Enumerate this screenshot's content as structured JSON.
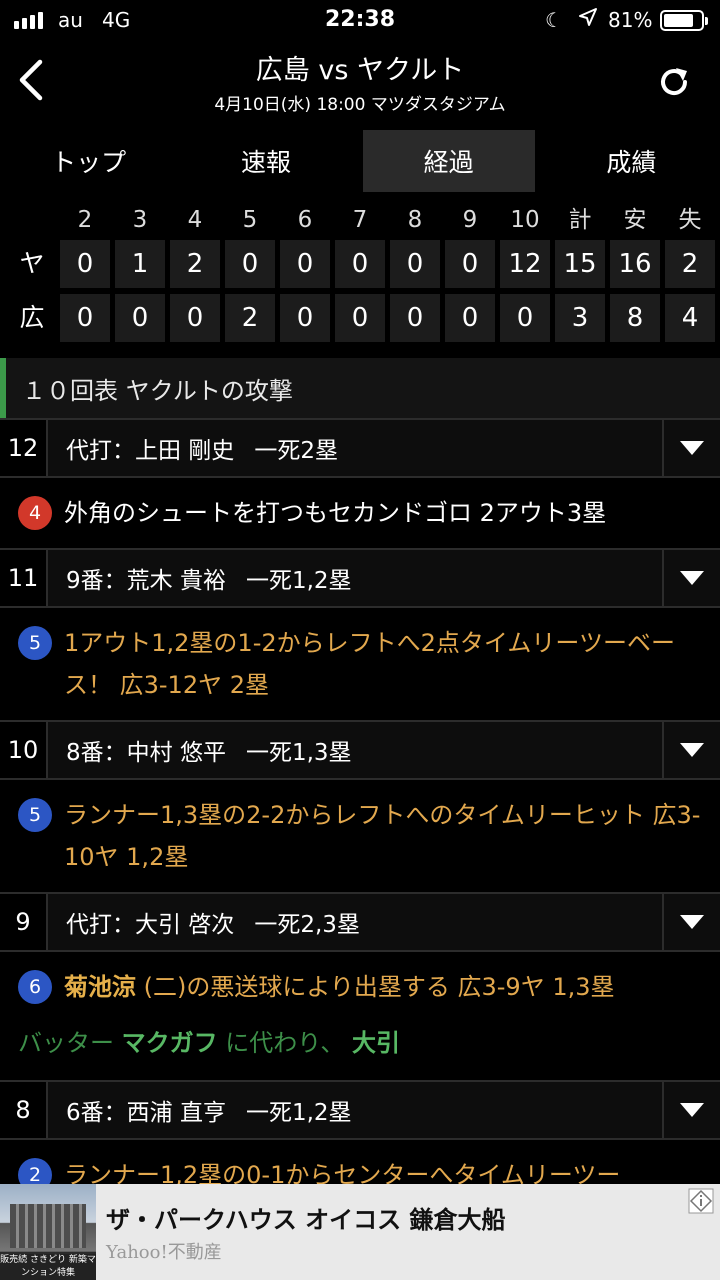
{
  "status_bar": {
    "carrier": "au",
    "network": "4G",
    "time": "22:38",
    "battery_pct": "81%",
    "battery_level": 0.81
  },
  "header": {
    "title": "広島 vs ヤクルト",
    "subtitle": "4月10日(水) 18:00 マツダスタジアム"
  },
  "tabs": [
    {
      "label": "トップ",
      "active": false
    },
    {
      "label": "速報",
      "active": false
    },
    {
      "label": "経過",
      "active": true
    },
    {
      "label": "成績",
      "active": false
    }
  ],
  "scoreboard": {
    "headers": [
      "2",
      "3",
      "4",
      "5",
      "6",
      "7",
      "8",
      "9",
      "10",
      "計",
      "安",
      "失"
    ],
    "rows": [
      {
        "team": "ヤ",
        "values": [
          "0",
          "1",
          "2",
          "0",
          "0",
          "0",
          "0",
          "0",
          "12",
          "15",
          "16",
          "2"
        ]
      },
      {
        "team": "広",
        "values": [
          "0",
          "0",
          "0",
          "2",
          "0",
          "0",
          "0",
          "0",
          "0",
          "3",
          "8",
          "4"
        ]
      }
    ]
  },
  "feed": {
    "section_title": "１０回表 ヤクルトの攻撃",
    "entries": [
      {
        "number": "12",
        "batter": "代打：上田 剛史",
        "state": "一死2塁",
        "pitch_count": "4",
        "ball_color": "red",
        "text_style": "white",
        "text": "外角のシュートを打つもセカンドゴロ 2アウト3塁"
      },
      {
        "number": "11",
        "batter": "9番：荒木 貴裕",
        "state": "一死1,2塁",
        "pitch_count": "5",
        "ball_color": "blue",
        "text_style": "orange",
        "text": "1アウト1,2塁の1-2からレフトへ2点タイムリーツーベース！ 広3-12ヤ 2塁"
      },
      {
        "number": "10",
        "batter": "8番：中村 悠平",
        "state": "一死1,3塁",
        "pitch_count": "5",
        "ball_color": "blue",
        "text_style": "orange",
        "text": "ランナー1,3塁の2-2からレフトへのタイムリーヒット 広3-10ヤ 1,2塁"
      },
      {
        "number": "9",
        "batter": "代打：大引 啓次",
        "state": "一死2,3塁",
        "pitch_count": "6",
        "ball_color": "blue",
        "text_style": "orange",
        "text_name": "菊池涼",
        "text": " (二)の悪送球により出塁する 広3-9ヤ 1,3塁",
        "sub": {
          "prefix": "バッター",
          "out_player": "マクガフ",
          "middle": "に代わり、",
          "in_player": "大引"
        }
      },
      {
        "number": "8",
        "batter": "6番：西浦 直亨",
        "state": "一死1,2塁",
        "pitch_count": "2",
        "ball_color": "blue",
        "text_style": "orange",
        "text": "ランナー1,2塁の0-1からセンターへタイムリーツー"
      }
    ]
  },
  "ad": {
    "title": "ザ・パークハウス オイコス 鎌倉大船",
    "source": "Yahoo!不動産",
    "thumb_caption": "販売続 さきどり 新築マンション特集"
  },
  "colors": {
    "background": "#000000",
    "accent_green": "#3c9a4a",
    "orange_text": "#e2a84e",
    "ball_red": "#d2382a",
    "ball_blue": "#2c56c4"
  }
}
